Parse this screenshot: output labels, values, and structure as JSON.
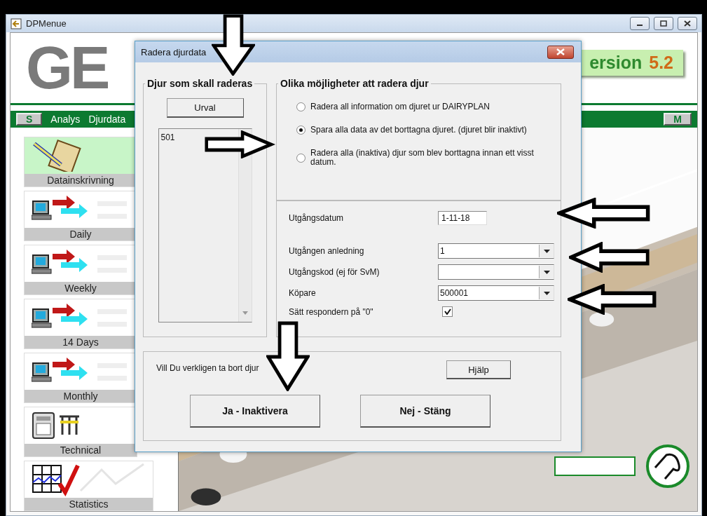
{
  "window": {
    "title": "DPMenue"
  },
  "header": {
    "logo": "GE",
    "version_label": "ersion",
    "version_number": "5.2"
  },
  "menu": {
    "left_button": "S",
    "items": [
      "Analys",
      "Djurdata"
    ],
    "right_button": "M"
  },
  "sidebar": [
    {
      "label": "Datainskrivning",
      "kind": "entry",
      "selected": true
    },
    {
      "label": "Daily",
      "kind": "transfer",
      "selected": false
    },
    {
      "label": "Weekly",
      "kind": "transfer",
      "selected": false
    },
    {
      "label": "14 Days",
      "kind": "transfer",
      "selected": false
    },
    {
      "label": "Monthly",
      "kind": "transfer",
      "selected": false
    },
    {
      "label": "Technical",
      "kind": "technical",
      "selected": false
    },
    {
      "label": "Statistics",
      "kind": "statistics",
      "selected": false
    }
  ],
  "dialog": {
    "title": "Radera djurdata",
    "animals_group": {
      "title": "Djur som skall raderas",
      "button": "Urval",
      "list": [
        "501"
      ]
    },
    "options_group": {
      "title": "Olika möjligheter att radera djur",
      "options": [
        {
          "label": "Radera all information om djuret ur DAIRYPLAN",
          "selected": false
        },
        {
          "label": "Spara alla data av det borttagna djuret. (djuret blir inaktivt)",
          "selected": true
        },
        {
          "label": "Radera alla (inaktiva) djur som blev borttagna innan ett visst datum.",
          "selected": false
        }
      ]
    },
    "fields": [
      {
        "label": "Utgångsdatum",
        "kind": "text",
        "value": "1-11-18"
      },
      {
        "label": "Utgången anledning",
        "kind": "dropdown",
        "value": "1"
      },
      {
        "label": "Utgångskod (ej för SvM)",
        "kind": "dropdown"
      },
      {
        "label": "Köpare",
        "kind": "dropdown",
        "value": "500001"
      },
      {
        "label": "Sätt respondern på \"0\"",
        "kind": "checkbox",
        "checked": true
      }
    ],
    "confirm": {
      "question": "Vill Du verkligen ta bort djur",
      "help_button": "Hjälp",
      "buttons": [
        "Ja - Inaktivera",
        "Nej - Stäng"
      ]
    }
  },
  "annotations": [
    {
      "kind": "arrow_down"
    },
    {
      "kind": "arrow_right"
    },
    {
      "kind": "arrow_left"
    },
    {
      "kind": "arrow_left"
    },
    {
      "kind": "arrow_left"
    },
    {
      "kind": "arrow_down"
    }
  ]
}
